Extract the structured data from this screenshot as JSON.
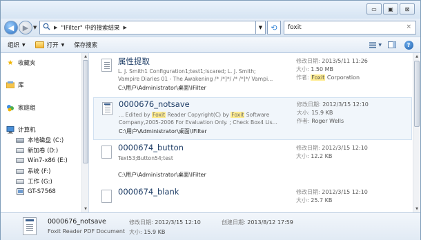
{
  "window": {
    "controls": {
      "minimize": "▭",
      "maximize": "▣",
      "close": "⊠"
    }
  },
  "nav": {
    "back_icon": "◀",
    "forward_icon": "▶",
    "address": {
      "segments": [
        "\"IFilter\" 中的搜索结果"
      ]
    },
    "refresh_icon": "⟲",
    "search_value": "foxit",
    "search_clear": "×"
  },
  "toolbar": {
    "organize": "组织",
    "open": "打开",
    "save_search": "保存搜索"
  },
  "sidebar": {
    "favorites": "收藏夹",
    "library": "库",
    "homegroup": "家庭组",
    "computer": "计算机",
    "drives": [
      {
        "label": "本地磁盘 (C:)"
      },
      {
        "label": "新加卷 (D:)"
      },
      {
        "label": "Win7-x86 (E:)"
      },
      {
        "label": "系统 (F:)"
      },
      {
        "label": "工作 (G:)"
      },
      {
        "label": "GT-S7568"
      }
    ]
  },
  "labels": {
    "modified": "修改日期:",
    "size": "大小:",
    "author": "作者:",
    "created": "创建日期:"
  },
  "results": [
    {
      "title": "属性提取",
      "snippet_line1": "L. J. Smith1 Configuration1;test1;Iscared; L. J. Smith;",
      "snippet_line2": "Vampire Diaries 01 - The Awakening /* /*]*/ /* /*]*/ Vampi...",
      "path": "C:\\用户\\Administrator\\桌面\\IFilter",
      "modified": "2013/5/11 11:26",
      "size": "1.50 MB",
      "author_hl": "Foxit",
      "author_rest": " Corporation"
    },
    {
      "title": "0000676_notsave",
      "snip_a": "... Edited by ",
      "snip_hl1": "Foxit",
      "snip_b": " Reader Copyright(C) by ",
      "snip_hl2": "Foxit",
      "snip_c": " Software",
      "snippet_line2": "Company,2005-2006 For Evaluation Only. ; Check Box4 Lis...",
      "path": "C:\\用户\\Administrator\\桌面\\IFilter",
      "modified": "2012/3/15 12:10",
      "size": "15.9 KB",
      "author": "Roger Wells"
    },
    {
      "title": "0000674_button",
      "snippet_line1": "Text53;Button54;test",
      "path": "C:\\用户\\Administrator\\桌面\\IFilter",
      "modified": "2012/3/15 12:10",
      "size": "12.2 KB"
    },
    {
      "title": "0000674_blank",
      "modified": "2012/3/15 12:10",
      "size": "25.7 KB"
    }
  ],
  "details": {
    "name": "0000676_notsave",
    "type": "Foxit Reader PDF Document",
    "modified": "2012/3/15 12:10",
    "size": "15.9 KB",
    "created": "2013/8/12 17:59"
  }
}
